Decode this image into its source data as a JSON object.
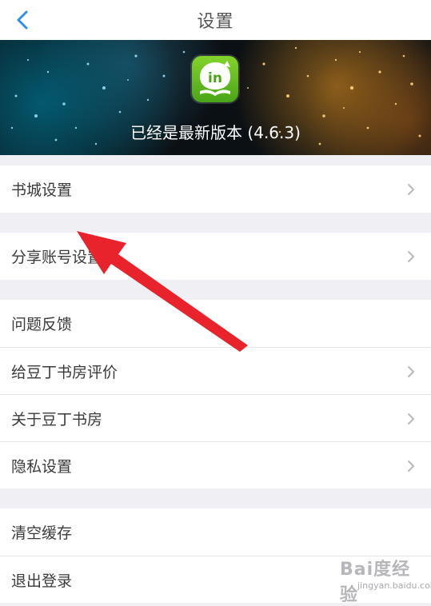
{
  "header": {
    "title": "设置"
  },
  "banner": {
    "version_text": "已经是最新版本 (4.6.3)"
  },
  "groups": [
    {
      "items": [
        {
          "label": "书城设置"
        }
      ]
    },
    {
      "items": [
        {
          "label": "分享账号设置"
        }
      ]
    },
    {
      "items": [
        {
          "label": "问题反馈"
        },
        {
          "label": "给豆丁书房评价"
        },
        {
          "label": "关于豆丁书房"
        },
        {
          "label": "隐私设置"
        }
      ]
    },
    {
      "items": [
        {
          "label": "清空缓存"
        },
        {
          "label": "退出登录"
        }
      ]
    }
  ],
  "watermark": {
    "text": "Bai度经验",
    "sub": "jingyan.baidu.com"
  },
  "colors": {
    "accent": "#2f8ef0",
    "background": "#efeff4",
    "annotation_arrow": "#e8232c",
    "app_icon_green": "#5cb21e"
  },
  "icons": {
    "back": "chevron-left-icon",
    "row_disclosure": "chevron-right-icon",
    "app": "app-logo-icon"
  }
}
